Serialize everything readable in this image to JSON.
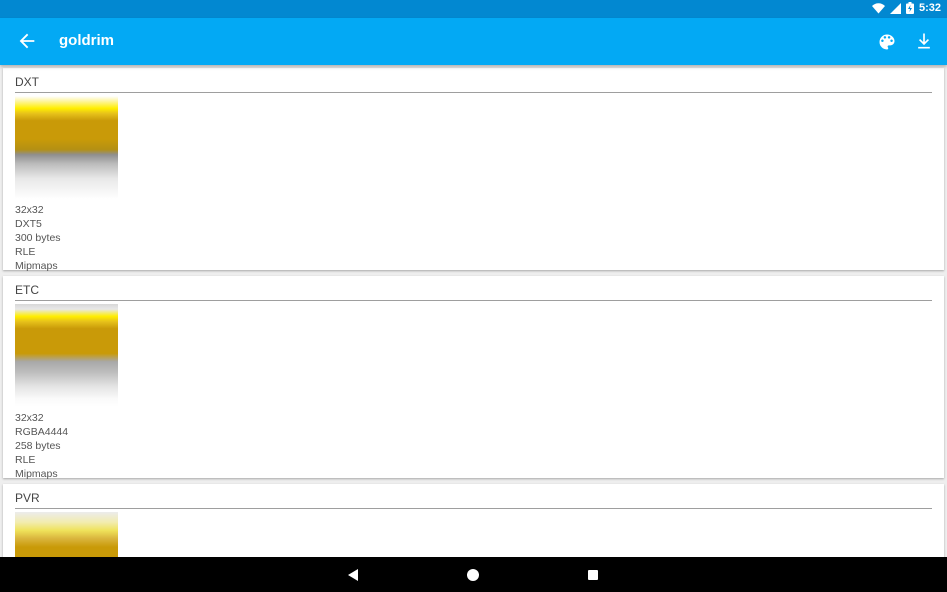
{
  "status_bar": {
    "time": "5:32",
    "icons": [
      "wifi-icon",
      "signal-icon",
      "battery-icon"
    ]
  },
  "app_bar": {
    "title": "goldrim",
    "back_icon": "arrow-back-icon",
    "actions": [
      "palette-icon",
      "download-icon"
    ],
    "color": "#03a9f4",
    "status_color": "#0288d1"
  },
  "sections": [
    {
      "header": "DXT",
      "info": [
        "32x32",
        "DXT5",
        "300 bytes",
        "RLE",
        "Mipmaps"
      ]
    },
    {
      "header": "ETC",
      "info": [
        "32x32",
        "RGBA4444",
        "258 bytes",
        "RLE",
        "Mipmaps"
      ]
    },
    {
      "header": "PVR",
      "info": []
    }
  ],
  "nav_bar": {
    "buttons": [
      "back-triangle-icon",
      "home-circle-icon",
      "recents-square-icon"
    ]
  }
}
